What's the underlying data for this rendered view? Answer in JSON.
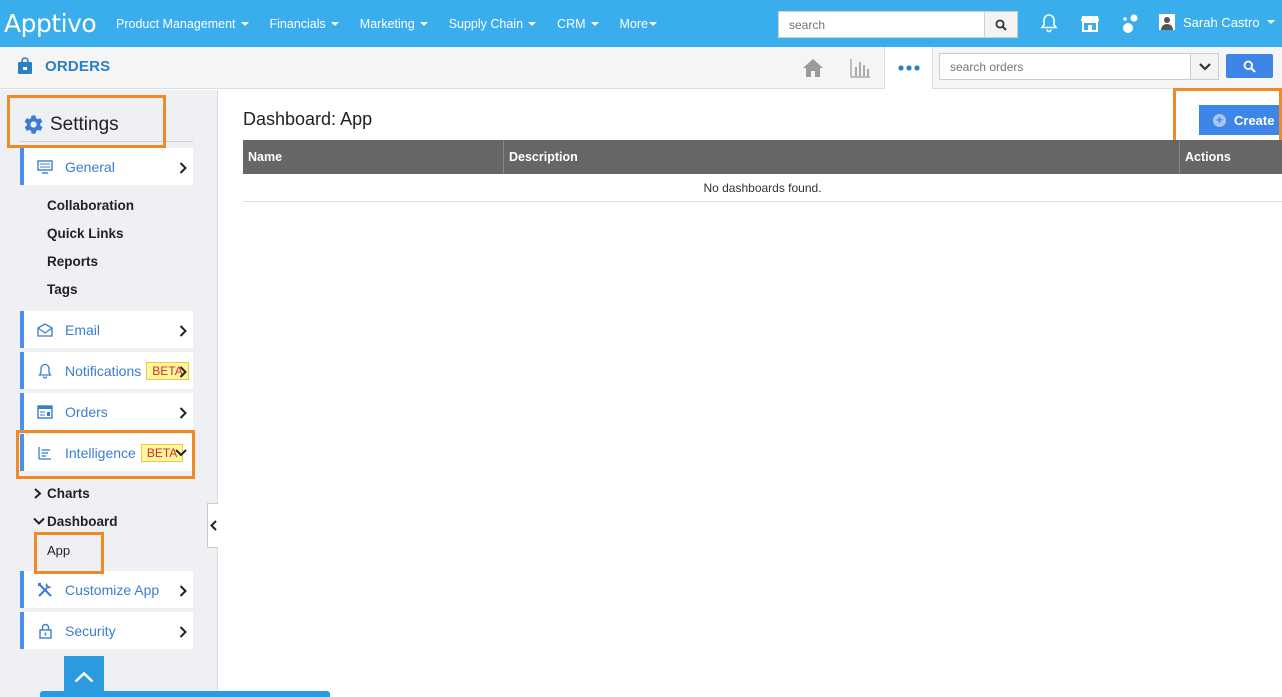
{
  "topbar": {
    "logo": "Apptivo",
    "menu": [
      {
        "label": "Product Management",
        "caret": true
      },
      {
        "label": "Financials",
        "caret": true
      },
      {
        "label": "Marketing",
        "caret": true
      },
      {
        "label": "Supply Chain",
        "caret": true
      },
      {
        "label": "CRM",
        "caret": true
      },
      {
        "label": "More",
        "caret": true
      }
    ],
    "search_placeholder": "search",
    "user_name": "Sarah Castro"
  },
  "subbar": {
    "app_title": "ORDERS",
    "search_placeholder": "search orders"
  },
  "sidebar": {
    "heading": "Settings",
    "general_label": "General",
    "general_links": [
      "Collaboration",
      "Quick Links",
      "Reports",
      "Tags"
    ],
    "email_label": "Email",
    "notifications_label": "Notifications",
    "notifications_badge": "BETA",
    "orders_label": "Orders",
    "intelligence_label": "Intelligence",
    "intelligence_badge": "BETA",
    "charts_label": "Charts",
    "dashboard_label": "Dashboard",
    "app_label": "App",
    "customize_label": "Customize App",
    "security_label": "Security"
  },
  "main": {
    "title": "Dashboard: App",
    "create_label": "Create",
    "columns": [
      "Name",
      "Description",
      "Actions"
    ],
    "empty_message": "No dashboards found."
  },
  "colors": {
    "topbar": "#3aaeed",
    "accent": "#3d86e8",
    "highlight": "#f08a24",
    "table_header": "#666666"
  }
}
